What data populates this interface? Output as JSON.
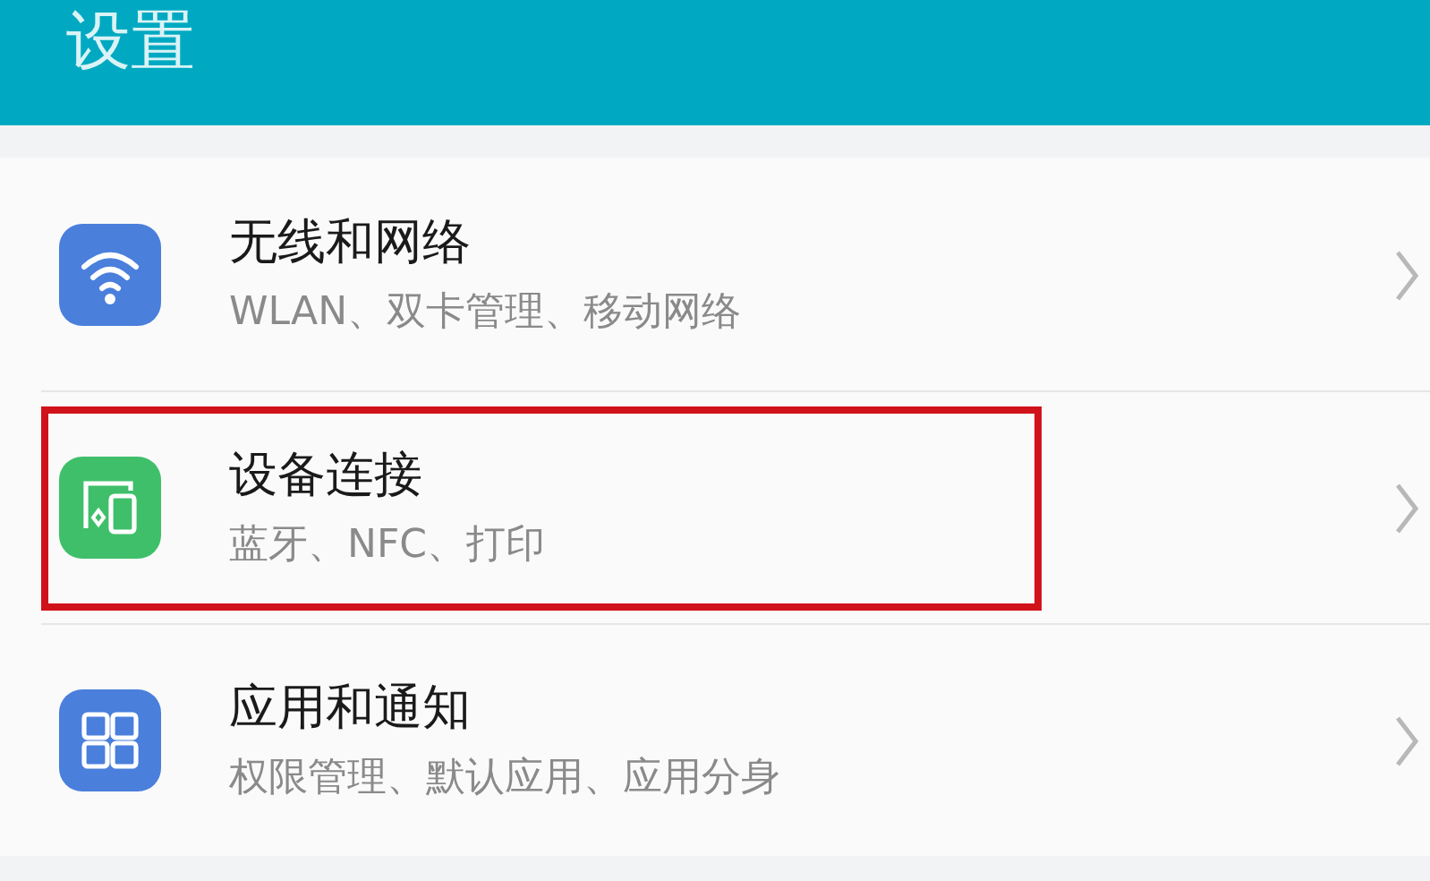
{
  "header": {
    "title": "设置"
  },
  "items": [
    {
      "kind": "wifi",
      "title": "无线和网络",
      "subtitle": "WLAN、双卡管理、移动网络",
      "highlighted": false
    },
    {
      "kind": "devices",
      "title": "设备连接",
      "subtitle": "蓝牙、NFC、打印",
      "highlighted": true
    },
    {
      "kind": "apps",
      "title": "应用和通知",
      "subtitle": "权限管理、默认应用、应用分身",
      "highlighted": false
    }
  ]
}
